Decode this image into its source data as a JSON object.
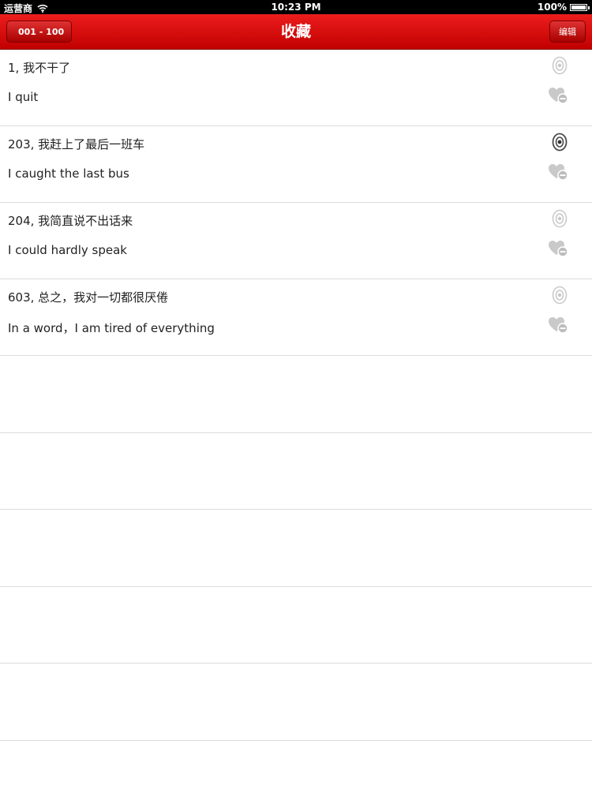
{
  "status_bar": {
    "carrier": "运营商",
    "time": "10:23 PM",
    "battery": "100%"
  },
  "nav": {
    "back_label": "001 - 100",
    "title": "收藏",
    "edit_label": "编辑"
  },
  "items": [
    {
      "chinese": "1, 我不干了",
      "english": "I quit",
      "speaker_active": false
    },
    {
      "chinese": "203, 我赶上了最后一班车",
      "english": "I caught the last bus",
      "speaker_active": true
    },
    {
      "chinese": "204, 我简直说不出话来",
      "english": "I could hardly speak",
      "speaker_active": false
    },
    {
      "chinese": "603, 总之，我对一切都很厌倦",
      "english": "In a word，I am tired of everything",
      "speaker_active": false
    }
  ],
  "icons": {
    "speaker": "speaker-icon",
    "heart_remove": "heart-minus-icon",
    "wifi": "wifi-icon"
  }
}
